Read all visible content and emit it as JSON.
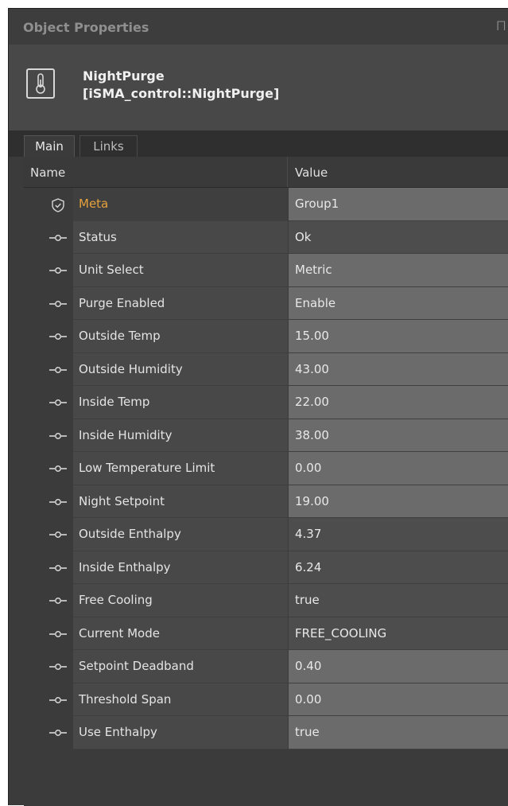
{
  "panel": {
    "title": "Object Properties",
    "pin_glyph": "⨅"
  },
  "object": {
    "name": "NightPurge",
    "type": "[iSMA_control::NightPurge]",
    "icon": "thermometer-icon"
  },
  "tabs": [
    {
      "label": "Main",
      "active": true
    },
    {
      "label": "Links",
      "active": false
    }
  ],
  "grid": {
    "col_name": "Name",
    "col_value": "Value",
    "rows": [
      {
        "icon": "shield-icon",
        "name": "Meta",
        "value": "Group1",
        "editable": true,
        "meta": true
      },
      {
        "icon": "slot-icon",
        "name": "Status",
        "value": "Ok",
        "editable": false
      },
      {
        "icon": "slot-icon",
        "name": "Unit Select",
        "value": "Metric",
        "editable": true
      },
      {
        "icon": "slot-icon",
        "name": "Purge Enabled",
        "value": "Enable",
        "editable": true
      },
      {
        "icon": "slot-icon",
        "name": "Outside Temp",
        "value": "15.00",
        "editable": true
      },
      {
        "icon": "slot-icon",
        "name": "Outside Humidity",
        "value": "43.00",
        "editable": true
      },
      {
        "icon": "slot-icon",
        "name": "Inside Temp",
        "value": "22.00",
        "editable": true
      },
      {
        "icon": "slot-icon",
        "name": "Inside Humidity",
        "value": "38.00",
        "editable": true
      },
      {
        "icon": "slot-icon",
        "name": "Low Temperature Limit",
        "value": "0.00",
        "editable": true
      },
      {
        "icon": "slot-icon",
        "name": "Night Setpoint",
        "value": "19.00",
        "editable": true
      },
      {
        "icon": "slot-icon",
        "name": "Outside Enthalpy",
        "value": "4.37",
        "editable": false
      },
      {
        "icon": "slot-icon",
        "name": "Inside Enthalpy",
        "value": "6.24",
        "editable": false
      },
      {
        "icon": "slot-icon",
        "name": "Free Cooling",
        "value": "true",
        "editable": false
      },
      {
        "icon": "slot-icon",
        "name": "Current Mode",
        "value": "FREE_COOLING",
        "editable": false
      },
      {
        "icon": "slot-icon",
        "name": "Setpoint Deadband",
        "value": "0.40",
        "editable": true
      },
      {
        "icon": "slot-icon",
        "name": "Threshold Span",
        "value": "0.00",
        "editable": true
      },
      {
        "icon": "slot-icon",
        "name": "Use Enthalpy",
        "value": "true",
        "editable": true
      }
    ]
  },
  "colors": {
    "meta_accent": "#e6a23c",
    "panel_bg": "#3b3b3b",
    "editable_value_bg": "#6b6b6b",
    "readonly_value_bg": "#4d4d4d"
  }
}
